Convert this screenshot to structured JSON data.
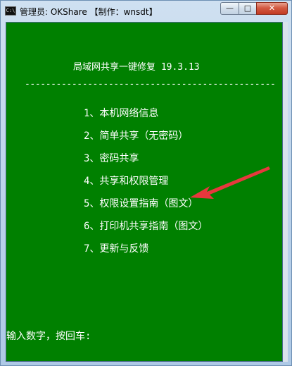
{
  "window": {
    "title": "管理员:  OKShare  【制作：wnsdt】",
    "icon": "C:\\",
    "controls": {
      "minimize": "—",
      "maximize": "□",
      "close": "✕"
    }
  },
  "console": {
    "heading": "局域网共享一键修复 19.3.13",
    "divider": "------------------------------------------------",
    "menu": [
      "1、本机网络信息",
      "2、简单共享（无密码）",
      "3、密码共享",
      "4、共享和权限管理",
      "5、权限设置指南（图文）",
      "6、打印机共享指南（图文）",
      "7、更新与反馈"
    ],
    "prompt": "输入数字，按回车:"
  },
  "annotation": {
    "arrow_color": "#e8383d"
  },
  "colors": {
    "console_bg": "#008000",
    "console_text": "#ffffff"
  }
}
